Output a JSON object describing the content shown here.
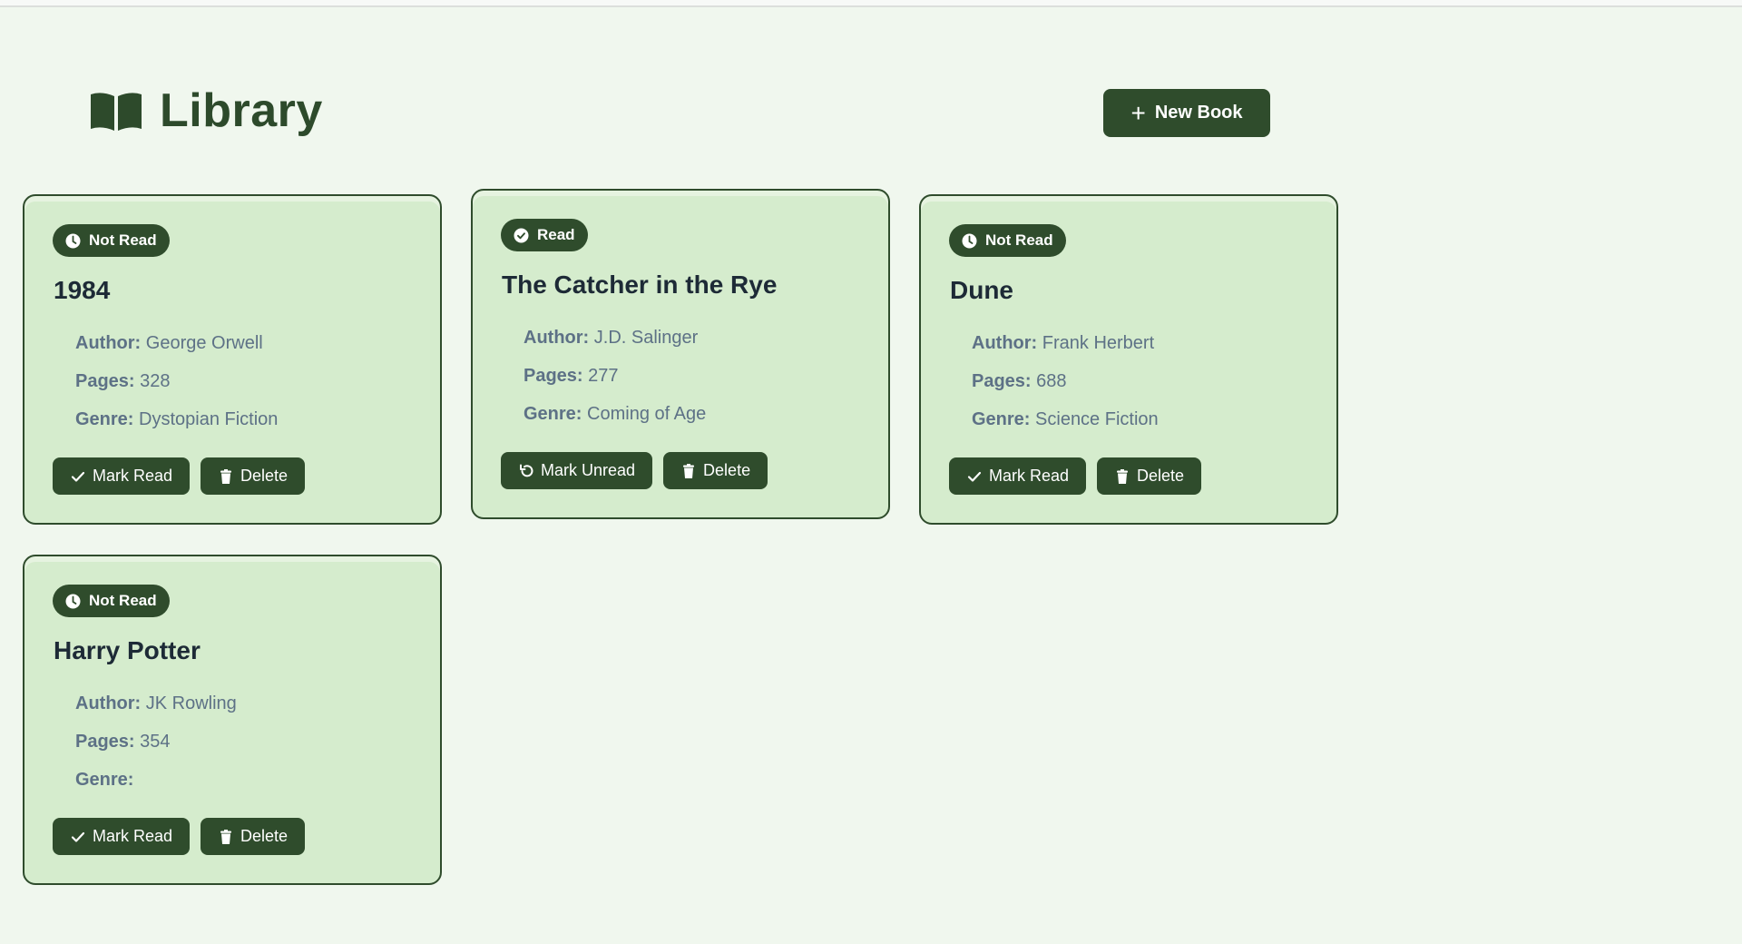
{
  "header": {
    "title": "Library",
    "icon": "open-book-icon",
    "new_book_label": "New Book"
  },
  "colors": {
    "background": "#f0f7ee",
    "card": "#d5eccd",
    "accent": "#2f4c2c",
    "title_text": "#2d4a2b",
    "field_text": "#5d7186"
  },
  "labels": {
    "author": "Author:",
    "pages": "Pages:",
    "genre": "Genre:"
  },
  "books": [
    {
      "status": "Not Read",
      "status_icon": "clock-icon",
      "title": "1984",
      "author": "George Orwell",
      "pages": "328",
      "genre": "Dystopian Fiction",
      "toggle_label": "Mark Read",
      "toggle_icon": "check-icon",
      "delete_label": "Delete"
    },
    {
      "status": "Read",
      "status_icon": "check-circle-icon",
      "title": "The Catcher in the Rye",
      "author": "J.D. Salinger",
      "pages": "277",
      "genre": "Coming of Age",
      "toggle_label": "Mark Unread",
      "toggle_icon": "undo-icon",
      "delete_label": "Delete"
    },
    {
      "status": "Not Read",
      "status_icon": "clock-icon",
      "title": "Dune",
      "author": "Frank Herbert",
      "pages": "688",
      "genre": "Science Fiction",
      "toggle_label": "Mark Read",
      "toggle_icon": "check-icon",
      "delete_label": "Delete"
    },
    {
      "status": "Not Read",
      "status_icon": "clock-icon",
      "title": "Harry Potter",
      "author": "JK Rowling",
      "pages": "354",
      "genre": "",
      "toggle_label": "Mark Read",
      "toggle_icon": "check-icon",
      "delete_label": "Delete"
    }
  ]
}
